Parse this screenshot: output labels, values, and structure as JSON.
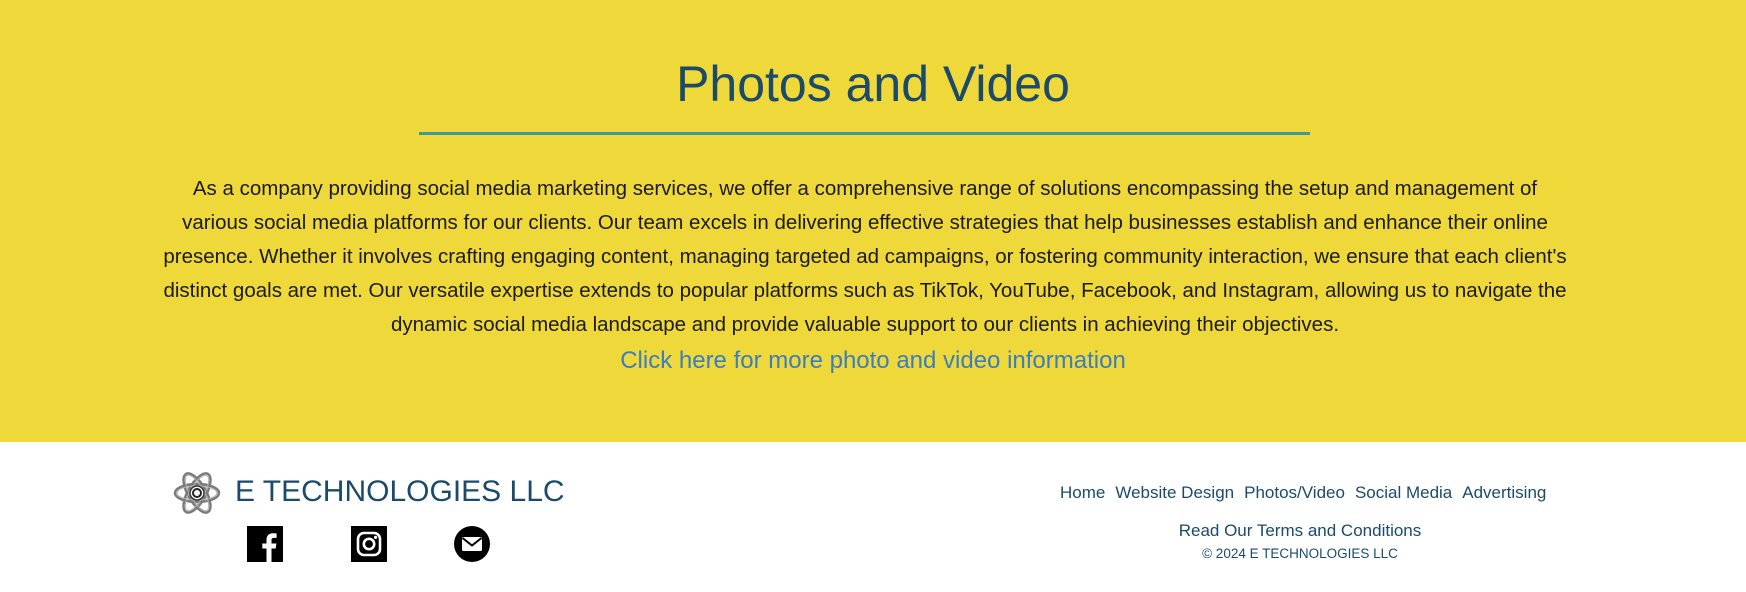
{
  "hero": {
    "title": "Photos and Video",
    "body": "As a company providing social media marketing services, we offer a comprehensive range of solutions encompassing the setup and management of various social media platforms for our clients. Our team excels in delivering effective strategies that help businesses establish and enhance their online presence. Whether it involves crafting engaging content, managing targeted ad campaigns, or fostering community interaction, we ensure that each client's distinct goals are met. Our versatile expertise extends to popular platforms such as TikTok, YouTube, Facebook, and Instagram, allowing us to navigate the dynamic social media landscape and provide valuable support to our clients in achieving their objectives.",
    "link_label": "Click here for more photo and video information"
  },
  "footer": {
    "brand": "E TECHNOLOGIES LLC",
    "logo_icon": "atom-logo-icon",
    "social": [
      {
        "icon": "facebook-icon"
      },
      {
        "icon": "instagram-icon"
      },
      {
        "icon": "email-icon"
      }
    ],
    "nav": [
      {
        "label": "Home"
      },
      {
        "label": "Website Design"
      },
      {
        "label": "Photos/Video"
      },
      {
        "label": "Social Media"
      },
      {
        "label": "Advertising"
      }
    ],
    "terms_label": "Read Our Terms and Conditions",
    "copyright": "© 2024 E TECHNOLOGIES LLC"
  },
  "colors": {
    "hero_background": "#efd839",
    "title": "#1b4a6b",
    "rule": "#3a9aa0",
    "link": "#3a7ec2"
  }
}
